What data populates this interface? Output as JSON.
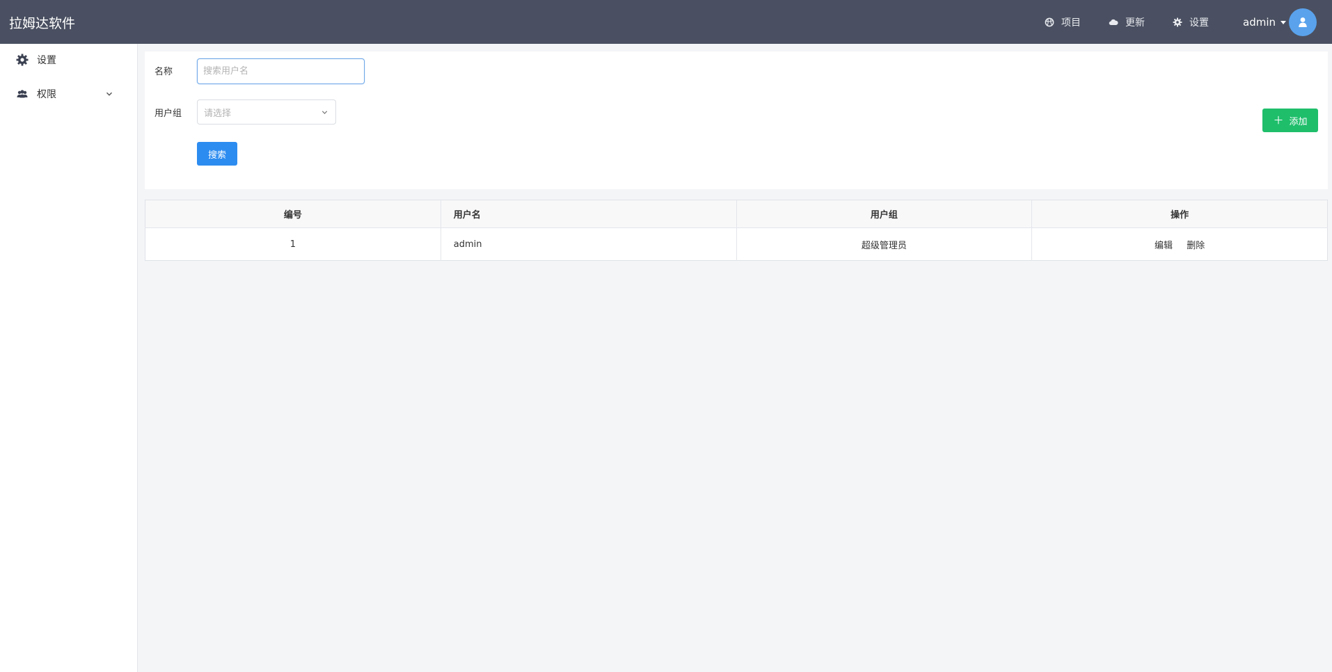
{
  "header": {
    "brand": "拉姆达软件",
    "nav": [
      {
        "label": "项目",
        "icon": "dribbble-icon"
      },
      {
        "label": "更新",
        "icon": "cloud-icon"
      },
      {
        "label": "设置",
        "icon": "gear-icon"
      }
    ],
    "user": "admin"
  },
  "sidebar": {
    "items": [
      {
        "label": "设置",
        "icon": "gear-icon"
      },
      {
        "label": "权限",
        "icon": "users-icon",
        "expandable": true
      }
    ]
  },
  "search": {
    "name_label": "名称",
    "name_placeholder": "搜索用户名",
    "group_label": "用户组",
    "group_placeholder": "请选择",
    "search_button": "搜索",
    "add_button": "添加"
  },
  "table": {
    "columns": [
      "编号",
      "用户名",
      "用户组",
      "操作"
    ],
    "rows": [
      {
        "id": "1",
        "username": "admin",
        "group": "超级管理员",
        "actions": [
          "编辑",
          "删除"
        ]
      }
    ]
  },
  "colors": {
    "header_bg": "#4a5061",
    "primary": "#2d8cf0",
    "success": "#1fbe6b",
    "avatar": "#5aa2ec"
  }
}
